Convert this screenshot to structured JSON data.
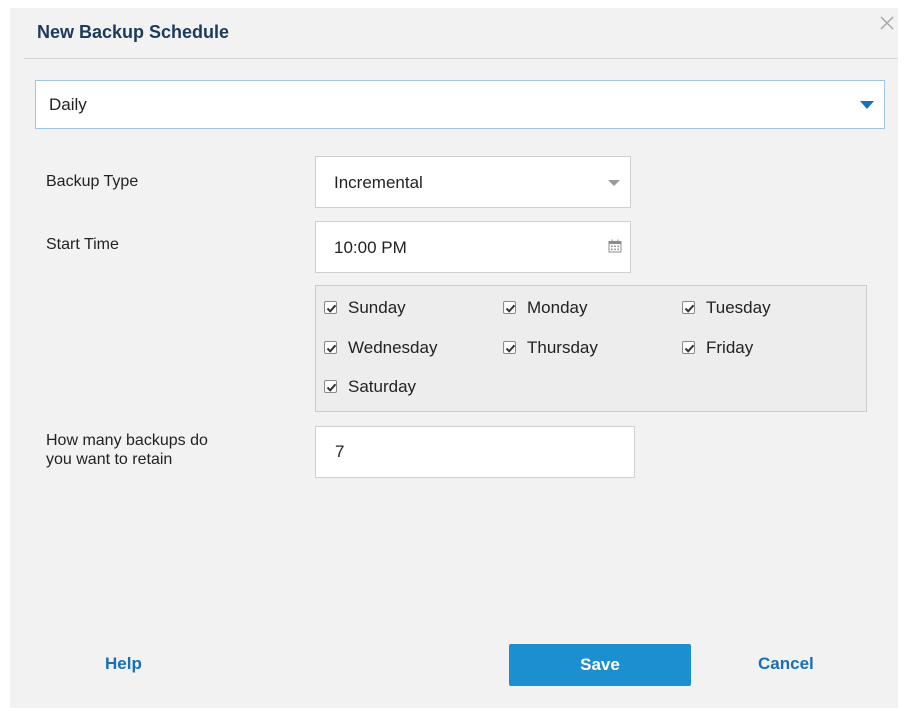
{
  "dialog": {
    "title": "New Backup Schedule",
    "close_icon": "close-icon"
  },
  "frequency": {
    "selected": "Daily",
    "caret_icon": "chevron-down-icon"
  },
  "backup_type": {
    "label": "Backup Type",
    "selected": "Incremental"
  },
  "start_time": {
    "label": "Start Time",
    "value": "10:00 PM",
    "icon": "calendar-icon"
  },
  "days": [
    {
      "label": "Sunday",
      "checked": true
    },
    {
      "label": "Monday",
      "checked": true
    },
    {
      "label": "Tuesday",
      "checked": true
    },
    {
      "label": "Wednesday",
      "checked": true
    },
    {
      "label": "Thursday",
      "checked": true
    },
    {
      "label": "Friday",
      "checked": true
    },
    {
      "label": "Saturday",
      "checked": true
    }
  ],
  "retain": {
    "label_line1": "How many backups do",
    "label_line2": "you want to retain",
    "value": "7"
  },
  "footer": {
    "help_label": "Help",
    "save_label": "Save",
    "cancel_label": "Cancel"
  },
  "colors": {
    "accent": "#1c8fd1",
    "link": "#1a6eb7",
    "title": "#1b3a5c",
    "dialog_bg": "#f2f2f2"
  }
}
